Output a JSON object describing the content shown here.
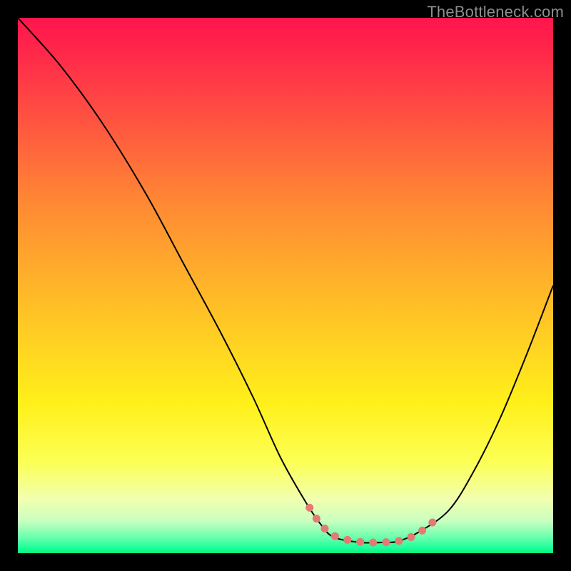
{
  "watermark": "TheBottleneck.com",
  "chart_data": {
    "type": "line",
    "title": "",
    "xlabel": "",
    "ylabel": "",
    "xlim": [
      0,
      100
    ],
    "ylim": [
      0,
      100
    ],
    "series": [
      {
        "name": "bottleneck-curve",
        "color": "#000000",
        "stroke_width": 2,
        "x": [
          0,
          8,
          16,
          24,
          31,
          38,
          44,
          49,
          53.5,
          56.5,
          59,
          64,
          68,
          71,
          75,
          80.5,
          85,
          90,
          95,
          100
        ],
        "y": [
          100,
          91,
          80,
          67,
          54,
          41,
          29,
          18,
          10,
          5.5,
          3,
          2,
          2,
          2.2,
          4,
          8,
          15,
          25,
          37,
          50
        ]
      },
      {
        "name": "bottleneck-highlight",
        "color": "#e47a72",
        "stroke_width": 11,
        "linecap": "round",
        "dash": [
          0.1,
          18
        ],
        "x": [
          54.5,
          56.5,
          59,
          62.5,
          66,
          69.5,
          72.5,
          75.5,
          78
        ],
        "y": [
          8.5,
          5.5,
          3.3,
          2.3,
          2.0,
          2.1,
          2.6,
          4.2,
          6.2
        ]
      }
    ]
  }
}
